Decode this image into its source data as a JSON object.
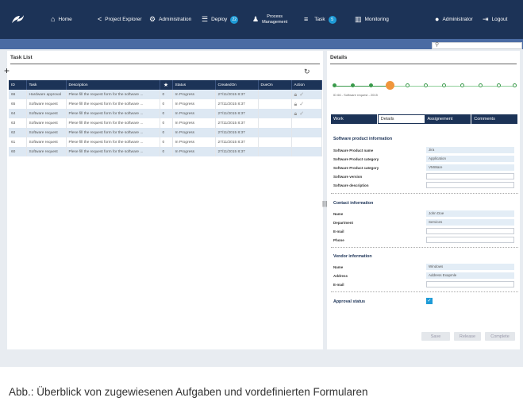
{
  "nav": {
    "home": "Home",
    "project_explorer": "Project Explorer",
    "administration": "Administration",
    "deploy": "Deploy",
    "deploy_badge": "22",
    "process_line1": "Process",
    "process_line2": "Management",
    "task": "Task",
    "task_badge": "5",
    "monitoring": "Monitoring",
    "user": "Administrator",
    "logout": "Logout"
  },
  "task_list": {
    "title": "Task List",
    "columns": [
      "ID",
      "Task",
      "Description",
      "",
      "Status",
      "CreatedOn",
      "DueOn",
      "Action"
    ],
    "rows": [
      {
        "id": "66",
        "task": "Hardware approval",
        "description": "Plese fill the request form for the software ...",
        "flag": "0",
        "status": "In Progress",
        "created": "27/11/2015  8:37",
        "due": "",
        "actions": true
      },
      {
        "id": "65",
        "task": "Software request",
        "description": "Plese fill the request form for the software ...",
        "flag": "0",
        "status": "In Progress",
        "created": "27/11/2015  8:37",
        "due": "",
        "actions": true
      },
      {
        "id": "64",
        "task": "Software request",
        "description": "Plese fill the request form for the software ...",
        "flag": "0",
        "status": "In Progress",
        "created": "27/11/2015  8:37",
        "due": "",
        "actions": true
      },
      {
        "id": "63",
        "task": "Software request",
        "description": "Plese fill the request form for the software ...",
        "flag": "0",
        "status": "In Progress",
        "created": "27/11/2015  8:37",
        "due": "",
        "actions": false
      },
      {
        "id": "62",
        "task": "Software request",
        "description": "Plese fill the request form for the software ...",
        "flag": "0",
        "status": "In Progress",
        "created": "27/11/2015  8:37",
        "due": "",
        "actions": false
      },
      {
        "id": "61",
        "task": "Software request",
        "description": "Plese fill the request form for the software ...",
        "flag": "0",
        "status": "In Progress",
        "created": "27/11/2015  8:37",
        "due": "",
        "actions": false
      },
      {
        "id": "60",
        "task": "Software request",
        "description": "Plese fill the request form for the software ...",
        "flag": "0",
        "status": "In Progress",
        "created": "27/11/2015  8:37",
        "due": "",
        "actions": false
      }
    ]
  },
  "details": {
    "title": "Details",
    "id_label": "ID 66 - Software request - 2015",
    "tabs": [
      "Work",
      "Details",
      "Assignement",
      "Comments"
    ],
    "software": {
      "heading": "Software product information",
      "name_label": "Software Product name",
      "name_value": "Jira",
      "cat1_label": "Software Product category",
      "cat1_value": "Application",
      "cat2_label": "Software Product category",
      "cat2_value": "VMWare",
      "version_label": "Software version",
      "description_label": "Software description"
    },
    "contact": {
      "heading": "Contact information",
      "name_label": "Name",
      "name_value": "John Doe",
      "dept_label": "Department",
      "dept_value": "Services",
      "email_label": "E-mail",
      "phone_label": "Phone"
    },
    "vendor": {
      "heading": "Vendor information",
      "name_label": "Name",
      "name_value": "Windows",
      "address_label": "Address",
      "address_value": "Address Exapmle",
      "email_label": "E-mail"
    },
    "approval_label": "Approval status",
    "buttons": {
      "save": "Save",
      "release": "Release",
      "complete": "Complete"
    }
  },
  "caption": "Abb.: Überblick von zugewiesenen Aufgaben und vordefinierten Formularen"
}
